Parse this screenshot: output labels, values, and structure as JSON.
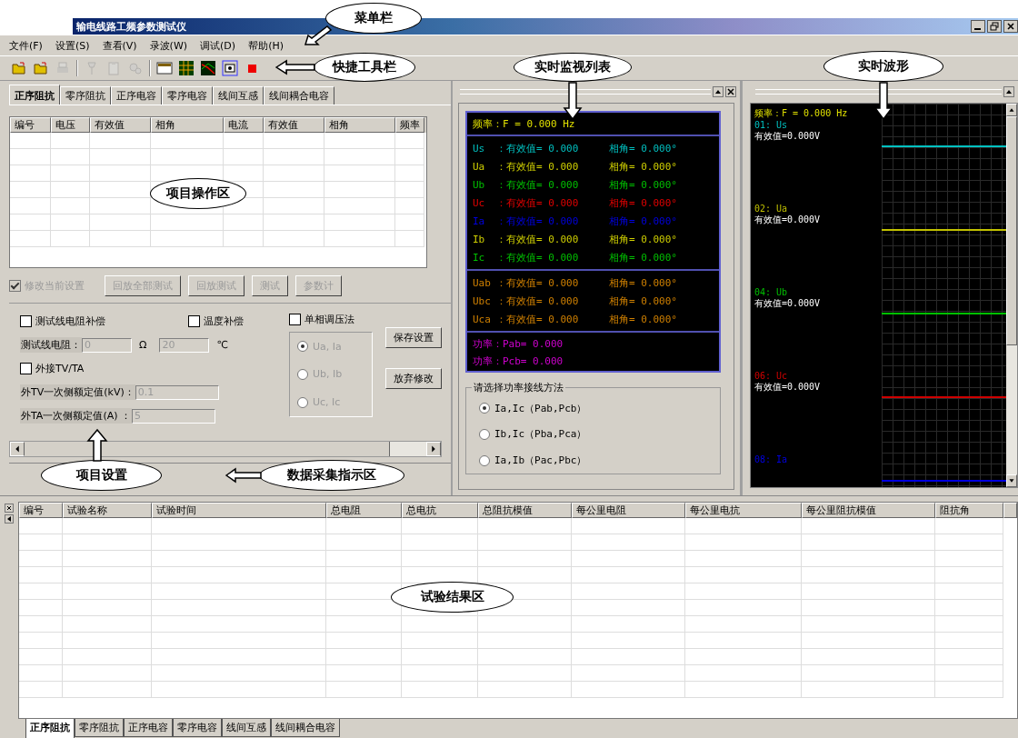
{
  "window": {
    "title": "输电线路工频参数测试仪"
  },
  "menu": [
    "文件(F)",
    "设置(S)",
    "查看(V)",
    "录波(W)",
    "调试(D)",
    "帮助(H)"
  ],
  "toolbar": [
    {
      "kind": "folder",
      "disabled": false
    },
    {
      "kind": "folder",
      "disabled": false
    },
    {
      "kind": "printer",
      "disabled": true
    },
    {
      "kind": "pin",
      "disabled": true
    },
    {
      "kind": "clipboard",
      "disabled": true
    },
    {
      "kind": "gear",
      "disabled": true
    },
    {
      "kind": "window",
      "disabled": false
    },
    {
      "kind": "grid",
      "disabled": false
    },
    {
      "kind": "chart",
      "disabled": false
    },
    {
      "kind": "monitor",
      "disabled": false
    },
    {
      "kind": "stop",
      "disabled": false
    }
  ],
  "project": {
    "tabs": [
      {
        "label": "正序阻抗",
        "selected": true
      },
      {
        "label": "零序阻抗",
        "selected": false
      },
      {
        "label": "正序电容",
        "selected": false
      },
      {
        "label": "零序电容",
        "selected": false
      },
      {
        "label": "线间互感",
        "selected": false
      },
      {
        "label": "线间耦合电容",
        "selected": false
      }
    ],
    "table": {
      "columns": [
        "编号",
        "电压",
        "有效值",
        "相角",
        "电流",
        "有效值",
        "相角",
        "频率"
      ]
    }
  },
  "settings": {
    "modify": {
      "label": "修改当前设置",
      "checked": true,
      "disabled": true
    },
    "actions": [
      {
        "label": "回放全部测试",
        "disabled": true
      },
      {
        "label": "回放测试",
        "disabled": true
      },
      {
        "label": "测试",
        "disabled": true
      },
      {
        "label": "参数计",
        "disabled": true
      }
    ],
    "line_compensation": {
      "label": "测试线电阻补偿",
      "checked": false
    },
    "line_resistance": {
      "label": "测试线电阻：",
      "value": "0",
      "unit": "Ω"
    },
    "temperature": {
      "label": "温度补偿",
      "checked": false,
      "value": "20",
      "unit": "℃"
    },
    "single_phase": {
      "label": "单相调压法",
      "checked": false
    },
    "phase_options": [
      {
        "label": "Ua, Ia",
        "selected": true
      },
      {
        "label": "Ub, Ib",
        "selected": false
      },
      {
        "label": "Uc, Ic",
        "selected": false
      }
    ],
    "external": {
      "label": "外接TV/TA",
      "checked": false
    },
    "tv_rating": {
      "label": "外TV一次侧额定值(kV)：",
      "value": "0.1"
    },
    "ta_rating": {
      "label": "外TA一次侧额定值(A) ：",
      "value": "5"
    },
    "buttons": [
      "保存设置",
      "放弃修改"
    ]
  },
  "monitor": {
    "frequency": "频率：F = 0.000 Hz",
    "groups": [
      [
        {
          "name": "Us",
          "value": "：有效值= 0.000",
          "angle": "相角= 0.000°",
          "color": "#00c0c0"
        },
        {
          "name": "Ua",
          "value": "：有效值= 0.000",
          "angle": "相角= 0.000°",
          "color": "#d0d000"
        },
        {
          "name": "Ub",
          "value": "：有效值= 0.000",
          "angle": "相角= 0.000°",
          "color": "#00c000"
        },
        {
          "name": "Uc",
          "value": "：有效值= 0.000",
          "angle": "相角= 0.000°",
          "color": "#e00000"
        },
        {
          "name": "Ia",
          "value": "：有效值= 0.000",
          "angle": "相角= 0.000°",
          "color": "#0000e0"
        },
        {
          "name": "Ib",
          "value": "：有效值= 0.000",
          "angle": "相角= 0.000°",
          "color": "#d0d000"
        },
        {
          "name": "Ic",
          "value": "：有效值= 0.000",
          "angle": "相角= 0.000°",
          "color": "#00c000"
        }
      ],
      [
        {
          "name": "Uab",
          "value": "：有效值= 0.000",
          "angle": "相角= 0.000°",
          "color": "#d08000"
        },
        {
          "name": "Ubc",
          "value": "：有效值= 0.000",
          "angle": "相角= 0.000°",
          "color": "#d08000"
        },
        {
          "name": "Uca",
          "value": "：有效值= 0.000",
          "angle": "相角= 0.000°",
          "color": "#d08000"
        }
      ]
    ],
    "power": [
      "功率：Pab= 0.000",
      "功率：Pcb= 0.000"
    ],
    "wiring": {
      "title": "请选择功率接线方法",
      "options": [
        {
          "label": "Ia,Ic（Pab,Pcb）",
          "selected": true
        },
        {
          "label": "Ib,Ic（Pba,Pca）",
          "selected": false
        },
        {
          "label": "Ia,Ib（Pac,Pbc）",
          "selected": false
        }
      ]
    }
  },
  "waveform": {
    "frequency": "频率：F = 0.000 Hz",
    "channels": [
      {
        "label": "01: Us",
        "reading": "有效值=0.000V",
        "color": "#00c0c0"
      },
      {
        "label": "02: Ua",
        "reading": "有效值=0.000V",
        "color": "#c0c000"
      },
      {
        "label": "04: Ub",
        "reading": "有效值=0.000V",
        "color": "#00c000"
      },
      {
        "label": "06: Uc",
        "reading": "有效值=0.000V",
        "color": "#d00000"
      },
      {
        "label": "08: Ia",
        "color": "#0000e0"
      }
    ]
  },
  "results": {
    "columns": [
      "编号",
      "试验名称",
      "试验时间",
      "总电阻",
      "总电抗",
      "总阻抗模值",
      "每公里电阻",
      "每公里电抗",
      "每公里阻抗模值",
      "阻抗角"
    ]
  },
  "bottom_tabs": [
    {
      "label": "正序阻抗",
      "selected": true
    },
    {
      "label": "零序阻抗",
      "selected": false
    },
    {
      "label": "正序电容",
      "selected": false
    },
    {
      "label": "零序电容",
      "selected": false
    },
    {
      "label": "线间互感",
      "selected": false
    },
    {
      "label": "线间耦合电容",
      "selected": false
    }
  ],
  "annotations": [
    {
      "text": "菜单栏"
    },
    {
      "text": "快捷工具栏"
    },
    {
      "text": "实时监视列表"
    },
    {
      "text": "实时波形"
    },
    {
      "text": "项目操作区"
    },
    {
      "text": "项目设置"
    },
    {
      "text": "数据采集指示区"
    },
    {
      "text": "试验结果区"
    }
  ]
}
